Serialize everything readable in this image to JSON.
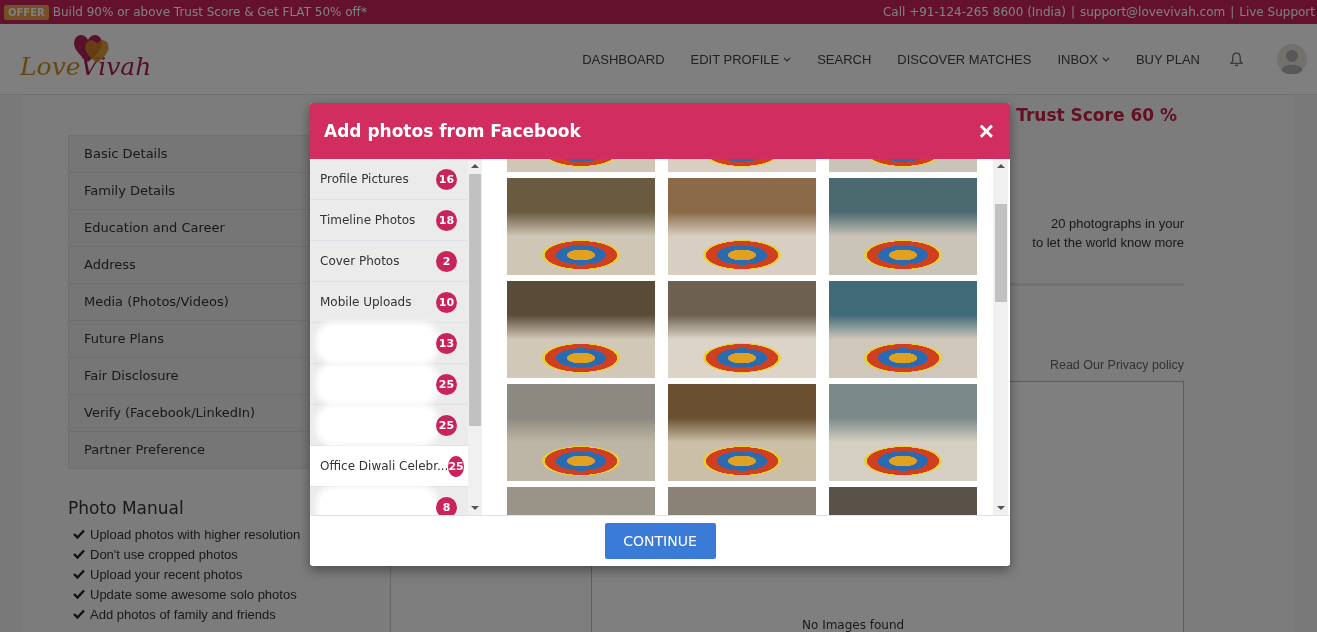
{
  "offer_bar": {
    "badge": "OFFER",
    "text": "Build 90% or above Trust Score & Get FLAT 50% off*",
    "contacts": [
      "Call +91-124-265 8600 (India)",
      "support@lovevivah.com",
      "Live Support"
    ],
    "separator": "|"
  },
  "logo": {
    "part_1": "Love",
    "part_2": "Vivah"
  },
  "nav": [
    {
      "label": "DASHBOARD",
      "dropdown": false
    },
    {
      "label": "EDIT PROFILE",
      "dropdown": true
    },
    {
      "label": "SEARCH",
      "dropdown": false
    },
    {
      "label": "DISCOVER MATCHES",
      "dropdown": false
    },
    {
      "label": "INBOX",
      "dropdown": true
    },
    {
      "label": "BUY PLAN",
      "dropdown": false
    }
  ],
  "profile_menu": [
    "Basic Details",
    "Family Details",
    "Education and Career",
    "Address",
    "Media (Photos/Videos)",
    "Future Plans",
    "Fair Disclosure",
    "Verify (Facebook/LinkedIn)",
    "Partner Preference"
  ],
  "photo_manual": {
    "title": "Photo Manual",
    "tips": [
      "Upload photos with higher resolution",
      "Don't use cropped photos",
      "Upload your recent photos",
      "Update some awesome solo photos",
      "Add photos of family and friends"
    ]
  },
  "trust_score": "Trust Score 60 %",
  "intro": [
    "20 photographs in your",
    "to let the world know more"
  ],
  "privacy_link": "Read Our Privacy policy",
  "empty_message": "No Images found",
  "modal": {
    "title": "Add photos from Facebook",
    "close": "×",
    "albums": [
      {
        "label": "Profile Pictures",
        "count": "16",
        "selected": false,
        "redacted": false
      },
      {
        "label": "Timeline Photos",
        "count": "18",
        "selected": false,
        "redacted": false
      },
      {
        "label": "Cover Photos",
        "count": "2",
        "selected": false,
        "redacted": false
      },
      {
        "label": "Mobile Uploads",
        "count": "10",
        "selected": false,
        "redacted": false
      },
      {
        "count": "13",
        "selected": false,
        "redacted": true
      },
      {
        "count": "25",
        "selected": false,
        "redacted": true
      },
      {
        "count": "25",
        "selected": false,
        "redacted": true
      },
      {
        "label": "Office Diwali Celebr...",
        "count": "25",
        "selected": true,
        "redacted": false
      },
      {
        "count": "8",
        "selected": false,
        "redacted": true
      }
    ],
    "continue": "CONTINUE"
  }
}
